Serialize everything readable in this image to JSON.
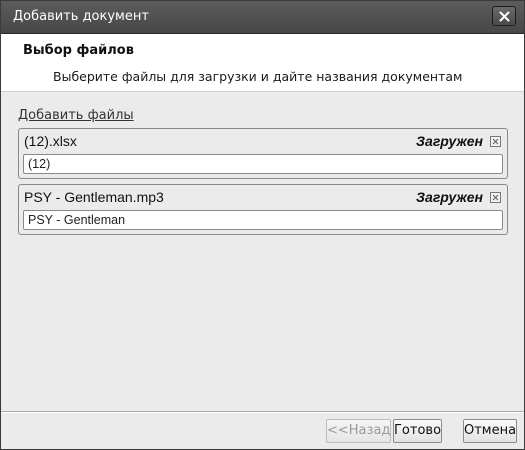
{
  "window": {
    "title": "Добавить документ",
    "close_icon": "close-icon"
  },
  "header": {
    "title": "Выбор файлов",
    "subtitle": "Выберите файлы для загрузки и дайте названия документам"
  },
  "add_files_link": "Добавить файлы",
  "files": [
    {
      "name": "(12).xlsx",
      "status": "Загружен",
      "document_name": "(12)",
      "remove_icon": "remove-icon"
    },
    {
      "name": "PSY - Gentleman.mp3",
      "status": "Загружен",
      "document_name": "PSY - Gentleman",
      "remove_icon": "remove-icon"
    }
  ],
  "buttons": {
    "back": "<<Назад",
    "done": "Готово",
    "cancel": "Отмена"
  }
}
